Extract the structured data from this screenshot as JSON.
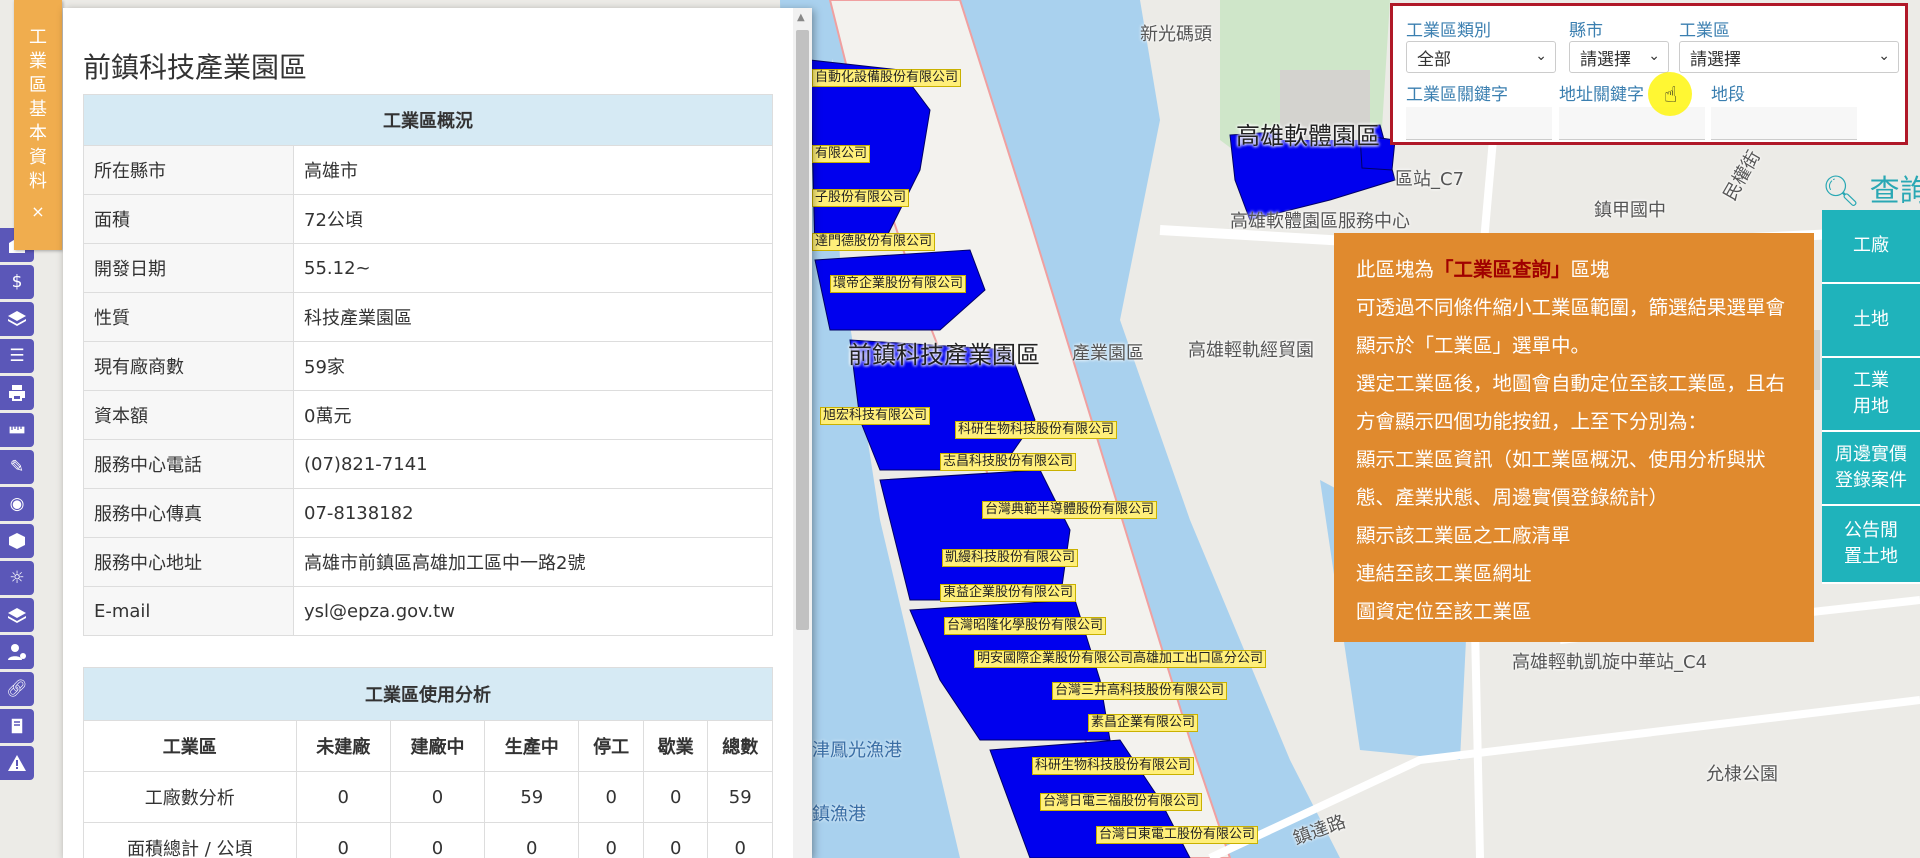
{
  "map": {
    "labels": {
      "xinguang_pier": "新光碼頭",
      "kaohsiung_software_park": "高雄軟體園區",
      "station_c7": "區站_C7",
      "kaohsiung_service_center": "高雄軟體園區服務中心",
      "jiajia_junior_high": "鎮甲國中",
      "minquan_street": "民權街",
      "qianzhen_park": "前鎮科技產業園區",
      "industrial_park_small": "產業園區",
      "lrt_trade_station": "高雄輕軌經貿園",
      "lrt_xuanzhong_station": "高雄輕軌凱旋中華站_C4",
      "fishing_port": "津鳳光漁港",
      "fishing_port2": "鎮漁港",
      "yunkang_park": "允棣公園",
      "xinda_road": "鎮達路"
    },
    "companies": [
      "自動化設備股份有限公司",
      "有限公司",
      "子股份有限公司",
      "達門德股份有限公司",
      "環帝企業股份有限公司",
      "旭宏科技有限公司",
      "科研生物科技股份有限公司",
      "志昌科技股份有限公司",
      "台灣典範半導體股份有限公司",
      "凱縵科技股份有限公司",
      "東益企業股份有限公司",
      "台灣昭隆化學股份有限公司",
      "明安國際企業股份有限公司高雄加工出口區分公司",
      "台灣三井高科技股份有限公司",
      "素昌企業有限公司",
      "科研生物科技股份有限公司",
      "台灣日電三福股份有限公司",
      "台灣日東電工股份有限公司"
    ]
  },
  "left_strip": {
    "icons": [
      "building-icon",
      "dollar-icon",
      "layers-icon",
      "list-icon",
      "print-icon",
      "ruler-icon",
      "pencil-icon",
      "eye-icon",
      "cube-icon",
      "sun-icon",
      "stack-icon",
      "user-gear-icon",
      "link-icon",
      "book-icon",
      "warning-icon"
    ]
  },
  "info_tab": {
    "label": "工業區基本資料",
    "close": "×"
  },
  "info_panel": {
    "title": "前鎮科技產業園區",
    "overview_caption": "工業區概況",
    "overview": [
      {
        "k": "所在縣市",
        "v": "高雄市"
      },
      {
        "k": "面積",
        "v": "72公頃"
      },
      {
        "k": "開發日期",
        "v": "55.12~"
      },
      {
        "k": "性質",
        "v": "科技產業園區"
      },
      {
        "k": "現有廠商數",
        "v": "59家"
      },
      {
        "k": "資本額",
        "v": "0萬元"
      },
      {
        "k": "服務中心電話",
        "v": "(07)821-7141"
      },
      {
        "k": "服務中心傳真",
        "v": "07-8138182"
      },
      {
        "k": "服務中心地址",
        "v": "高雄市前鎮區高雄加工區中一路2號"
      },
      {
        "k": "E-mail",
        "v": "ysl@epza.gov.tw"
      }
    ],
    "usage_caption": "工業區使用分析",
    "usage_headers": [
      "工業區",
      "未建廠",
      "建廠中",
      "生產中",
      "停工",
      "歇業",
      "總數"
    ],
    "usage_rows": [
      [
        "工廠數分析",
        "0",
        "0",
        "59",
        "0",
        "0",
        "59"
      ],
      [
        "面積總計 / 公頃",
        "0",
        "0",
        "0",
        "0",
        "0",
        "0"
      ]
    ]
  },
  "search_form": {
    "category_label": "工業區類別",
    "category_value": "全部",
    "county_label": "縣市",
    "county_value": "請選擇",
    "park_label": "工業區",
    "park_value": "請選擇",
    "park_keyword_label": "工業區關鍵字",
    "address_keyword_label": "地址關鍵字",
    "land_section_label": "地段"
  },
  "search_label": "查詢",
  "right_menu": {
    "factory": "工廠",
    "land": "土地",
    "industrial_land": "工業用地",
    "nearby_transactions": "周邊實價登錄案件",
    "announced_idle_land": "公告閒置土地"
  },
  "tip": {
    "line1_pre": "此區塊為",
    "line1_em": "「工業區查詢」",
    "line1_post": "區塊",
    "line2": "可透過不同條件縮小工業區範圍，篩選結果選單會顯示於「工業區」選單中。",
    "line3": "選定工業區後，地圖會自動定位至該工業區，且右方會顯示四個功能按鈕，上至下分別為：",
    "line4": "顯示工業區資訊（如工業區概況、使用分析與狀態、產業狀態、周邊實價登錄統計）",
    "line5": "顯示該工業區之工廠清單",
    "line6": "連結至該工業區網址",
    "line7": "圖資定位至該工業區"
  },
  "colors": {
    "tab_orange": "#f0ad4e",
    "tip_orange": "#e08a2e",
    "teal": "#1fb3bb",
    "strip_purple": "#5b57b8",
    "form_border": "#b01828",
    "factory_blue": "#0000ee"
  }
}
